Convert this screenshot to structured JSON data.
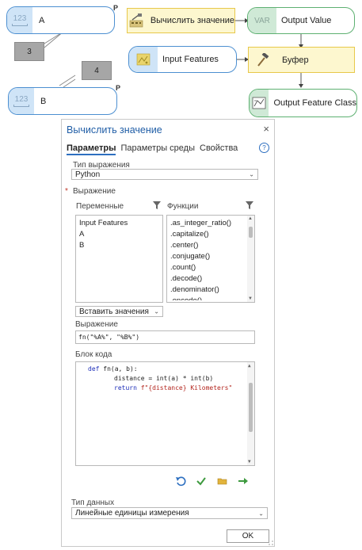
{
  "model": {
    "var_a": {
      "label": "A",
      "type_text": "123",
      "p_mark": "P"
    },
    "var_b": {
      "label": "B",
      "type_text": "123",
      "p_mark": "P"
    },
    "note_3": {
      "text": "3"
    },
    "note_4": {
      "text": "4"
    },
    "calc_tool": {
      "label": "Вычислить значение"
    },
    "output_value": {
      "label": "Output Value",
      "type_text": "VAR"
    },
    "input_features": {
      "label": "Input Features"
    },
    "buffer_tool": {
      "label": "Буфер"
    },
    "output_feature_class": {
      "label": "Output Feature Class"
    }
  },
  "dialog": {
    "title": "Вычислить значение",
    "close_label": "×",
    "tabs": [
      "Параметры",
      "Параметры среды",
      "Свойства"
    ],
    "help_label": "?",
    "expression_type": {
      "label": "Тип выражения",
      "value": "Python"
    },
    "expression_section": {
      "label": "Выражение",
      "required_mark": "*"
    },
    "variables": {
      "label": "Переменные",
      "items": [
        "Input Features",
        "A",
        "B"
      ]
    },
    "functions": {
      "label": "Функции",
      "items": [
        ".as_integer_ratio()",
        ".capitalize()",
        ".center()",
        ".conjugate()",
        ".count()",
        ".decode()",
        ".denominator()",
        ".encode()"
      ]
    },
    "insert_values": {
      "label": "Вставить значения"
    },
    "expression": {
      "label": "Выражение",
      "value": "fn(\"%A%\", \"%B%\")"
    },
    "code_block": {
      "label": "Блок кода",
      "line1_kw": "def",
      "line1_rest": " fn(a, b):",
      "line2": "distance = int(a) * int(b)",
      "line3_kw": "return",
      "line3_str": " f\"{distance} Kilometers\""
    },
    "data_type": {
      "label": "Тип данных",
      "value": "Линейные единицы измерения"
    },
    "ok_label": "OK"
  },
  "colors": {
    "accent": "#2d6fc0",
    "variable": "#4c8fd1",
    "tool": "#e7c84a",
    "output": "#5db071"
  }
}
